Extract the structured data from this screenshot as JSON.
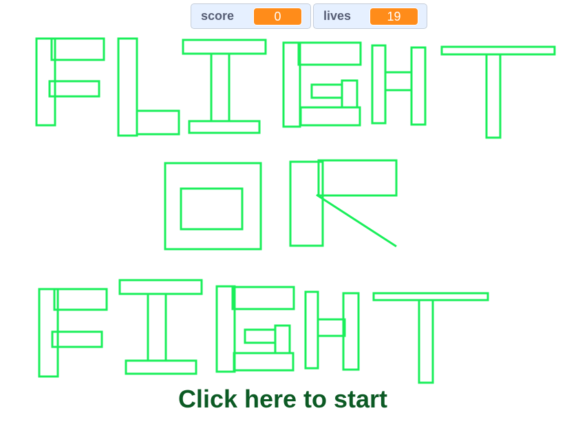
{
  "monitors": {
    "score": {
      "label": "score",
      "value": "0"
    },
    "lives": {
      "label": "lives",
      "value": "19"
    }
  },
  "start_prompt": "Click here to start",
  "colors": {
    "title_outline": "#1aef5a",
    "start_text": "#0c5a24",
    "monitor_value_bg": "#ff8c1a",
    "monitor_bg": "#e6f0ff"
  }
}
